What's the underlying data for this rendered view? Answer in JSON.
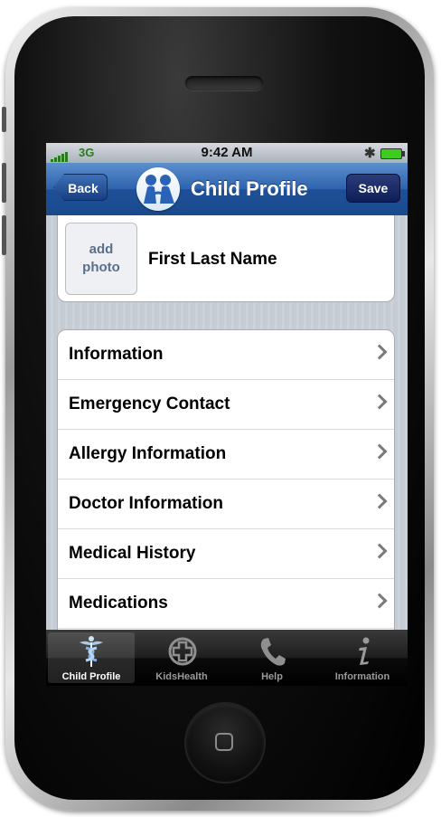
{
  "status_bar": {
    "carrier": "3G",
    "time": "9:42 AM"
  },
  "nav": {
    "back_label": "Back",
    "title": "Child Profile",
    "save_label": "Save"
  },
  "profile": {
    "photo_label": "add photo",
    "name": "First Last Name"
  },
  "menu": [
    {
      "label": "Information"
    },
    {
      "label": "Emergency Contact"
    },
    {
      "label": "Allergy Information"
    },
    {
      "label": "Doctor Information"
    },
    {
      "label": "Medical History"
    },
    {
      "label": "Medications"
    }
  ],
  "tabs": [
    {
      "label": "Child Profile",
      "icon": "caduceus-icon",
      "active": true
    },
    {
      "label": "KidsHealth",
      "icon": "medical-cross-icon",
      "active": false
    },
    {
      "label": "Help",
      "icon": "phone-icon",
      "active": false
    },
    {
      "label": "Information",
      "icon": "info-icon",
      "active": false
    }
  ],
  "colors": {
    "nav_blue": "#2d63ae",
    "save_blue": "#0e1f57",
    "tab_bar": "#000000"
  }
}
